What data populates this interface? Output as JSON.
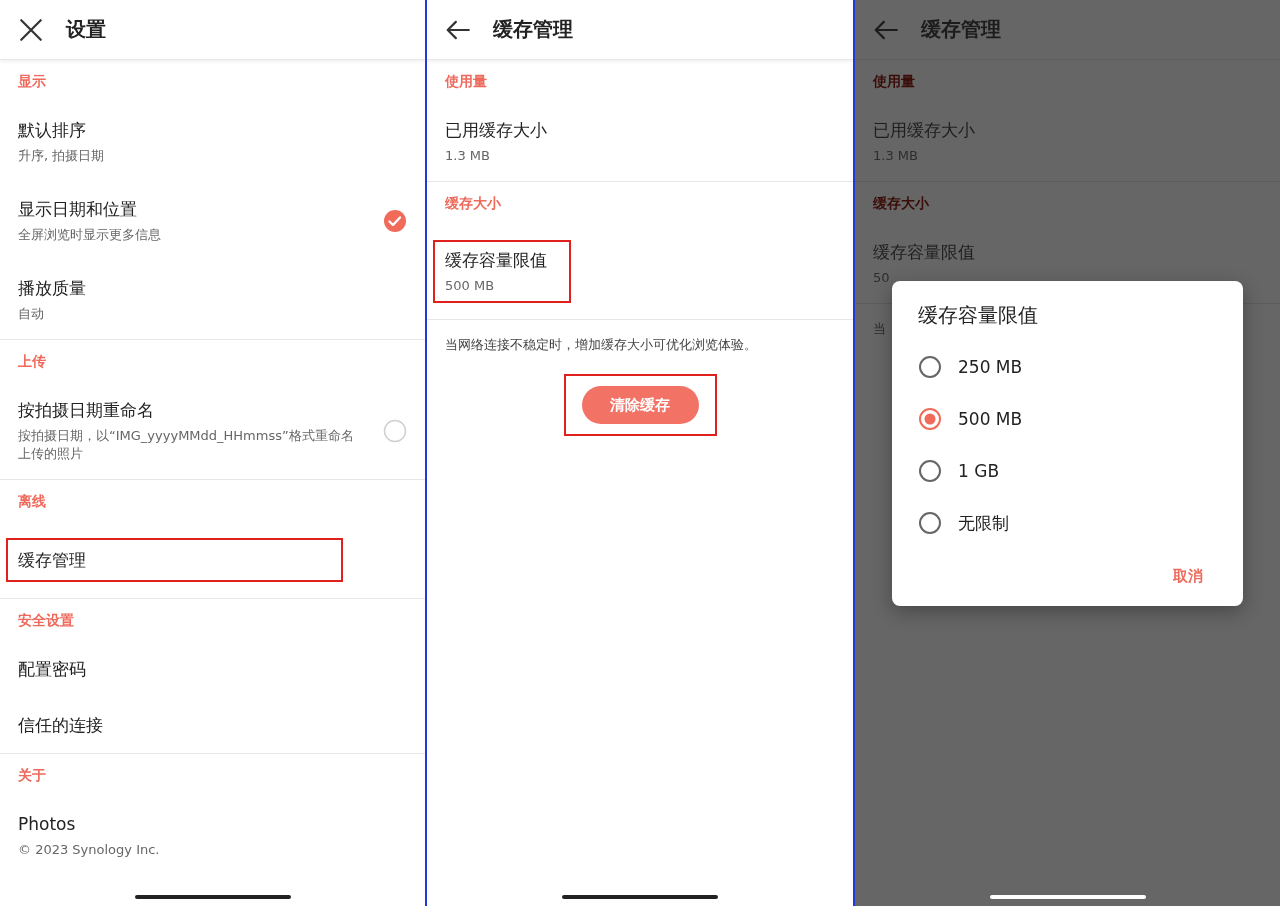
{
  "settings_screen": {
    "title": "设置",
    "sections": [
      {
        "title": "显示",
        "items": [
          {
            "title": "默认排序",
            "subtitle": "升序, 拍摄日期"
          },
          {
            "title": "显示日期和位置",
            "subtitle": "全屏浏览时显示更多信息",
            "checked": true
          },
          {
            "title": "播放质量",
            "subtitle": "自动"
          }
        ]
      },
      {
        "title": "上传",
        "items": [
          {
            "title": "按拍摄日期重命名",
            "subtitle": "按拍摄日期，以“IMG_yyyyMMdd_HHmmss”格式重命名上传的照片",
            "checked": false
          }
        ]
      },
      {
        "title": "离线",
        "items": [
          {
            "title": "缓存管理",
            "highlighted": true
          }
        ]
      },
      {
        "title": "安全设置",
        "items": [
          {
            "title": "配置密码"
          },
          {
            "title": "信任的连接"
          }
        ]
      },
      {
        "title": "关于",
        "items": [
          {
            "title": "Photos",
            "subtitle": "© 2023 Synology Inc."
          }
        ]
      }
    ]
  },
  "cache_screen": {
    "title": "缓存管理",
    "sections": [
      {
        "title": "使用量",
        "items": [
          {
            "title": "已用缓存大小",
            "subtitle": "1.3 MB"
          }
        ]
      },
      {
        "title": "缓存大小",
        "items": [
          {
            "title": "缓存容量限值",
            "subtitle": "500 MB",
            "highlighted": true
          }
        ]
      }
    ],
    "note": "当网络连接不稳定时，增加缓存大小可优化浏览体验。",
    "button": {
      "label": "清除缓存",
      "highlighted": true
    }
  },
  "dialog_screen": {
    "title": "缓存管理",
    "sections": [
      {
        "title": "使用量",
        "items": [
          {
            "title": "已用缓存大小",
            "subtitle": "1.3 MB"
          }
        ]
      },
      {
        "title": "缓存大小",
        "items": [
          {
            "title": "缓存容量限值",
            "subtitle": "50"
          }
        ]
      }
    ],
    "note": "当",
    "dialog": {
      "title": "缓存容量限值",
      "options": [
        {
          "label": "250 MB",
          "selected": false
        },
        {
          "label": "500 MB",
          "selected": true
        },
        {
          "label": "1 GB",
          "selected": false
        },
        {
          "label": "无限制",
          "selected": false
        }
      ],
      "cancel": "取消"
    }
  }
}
